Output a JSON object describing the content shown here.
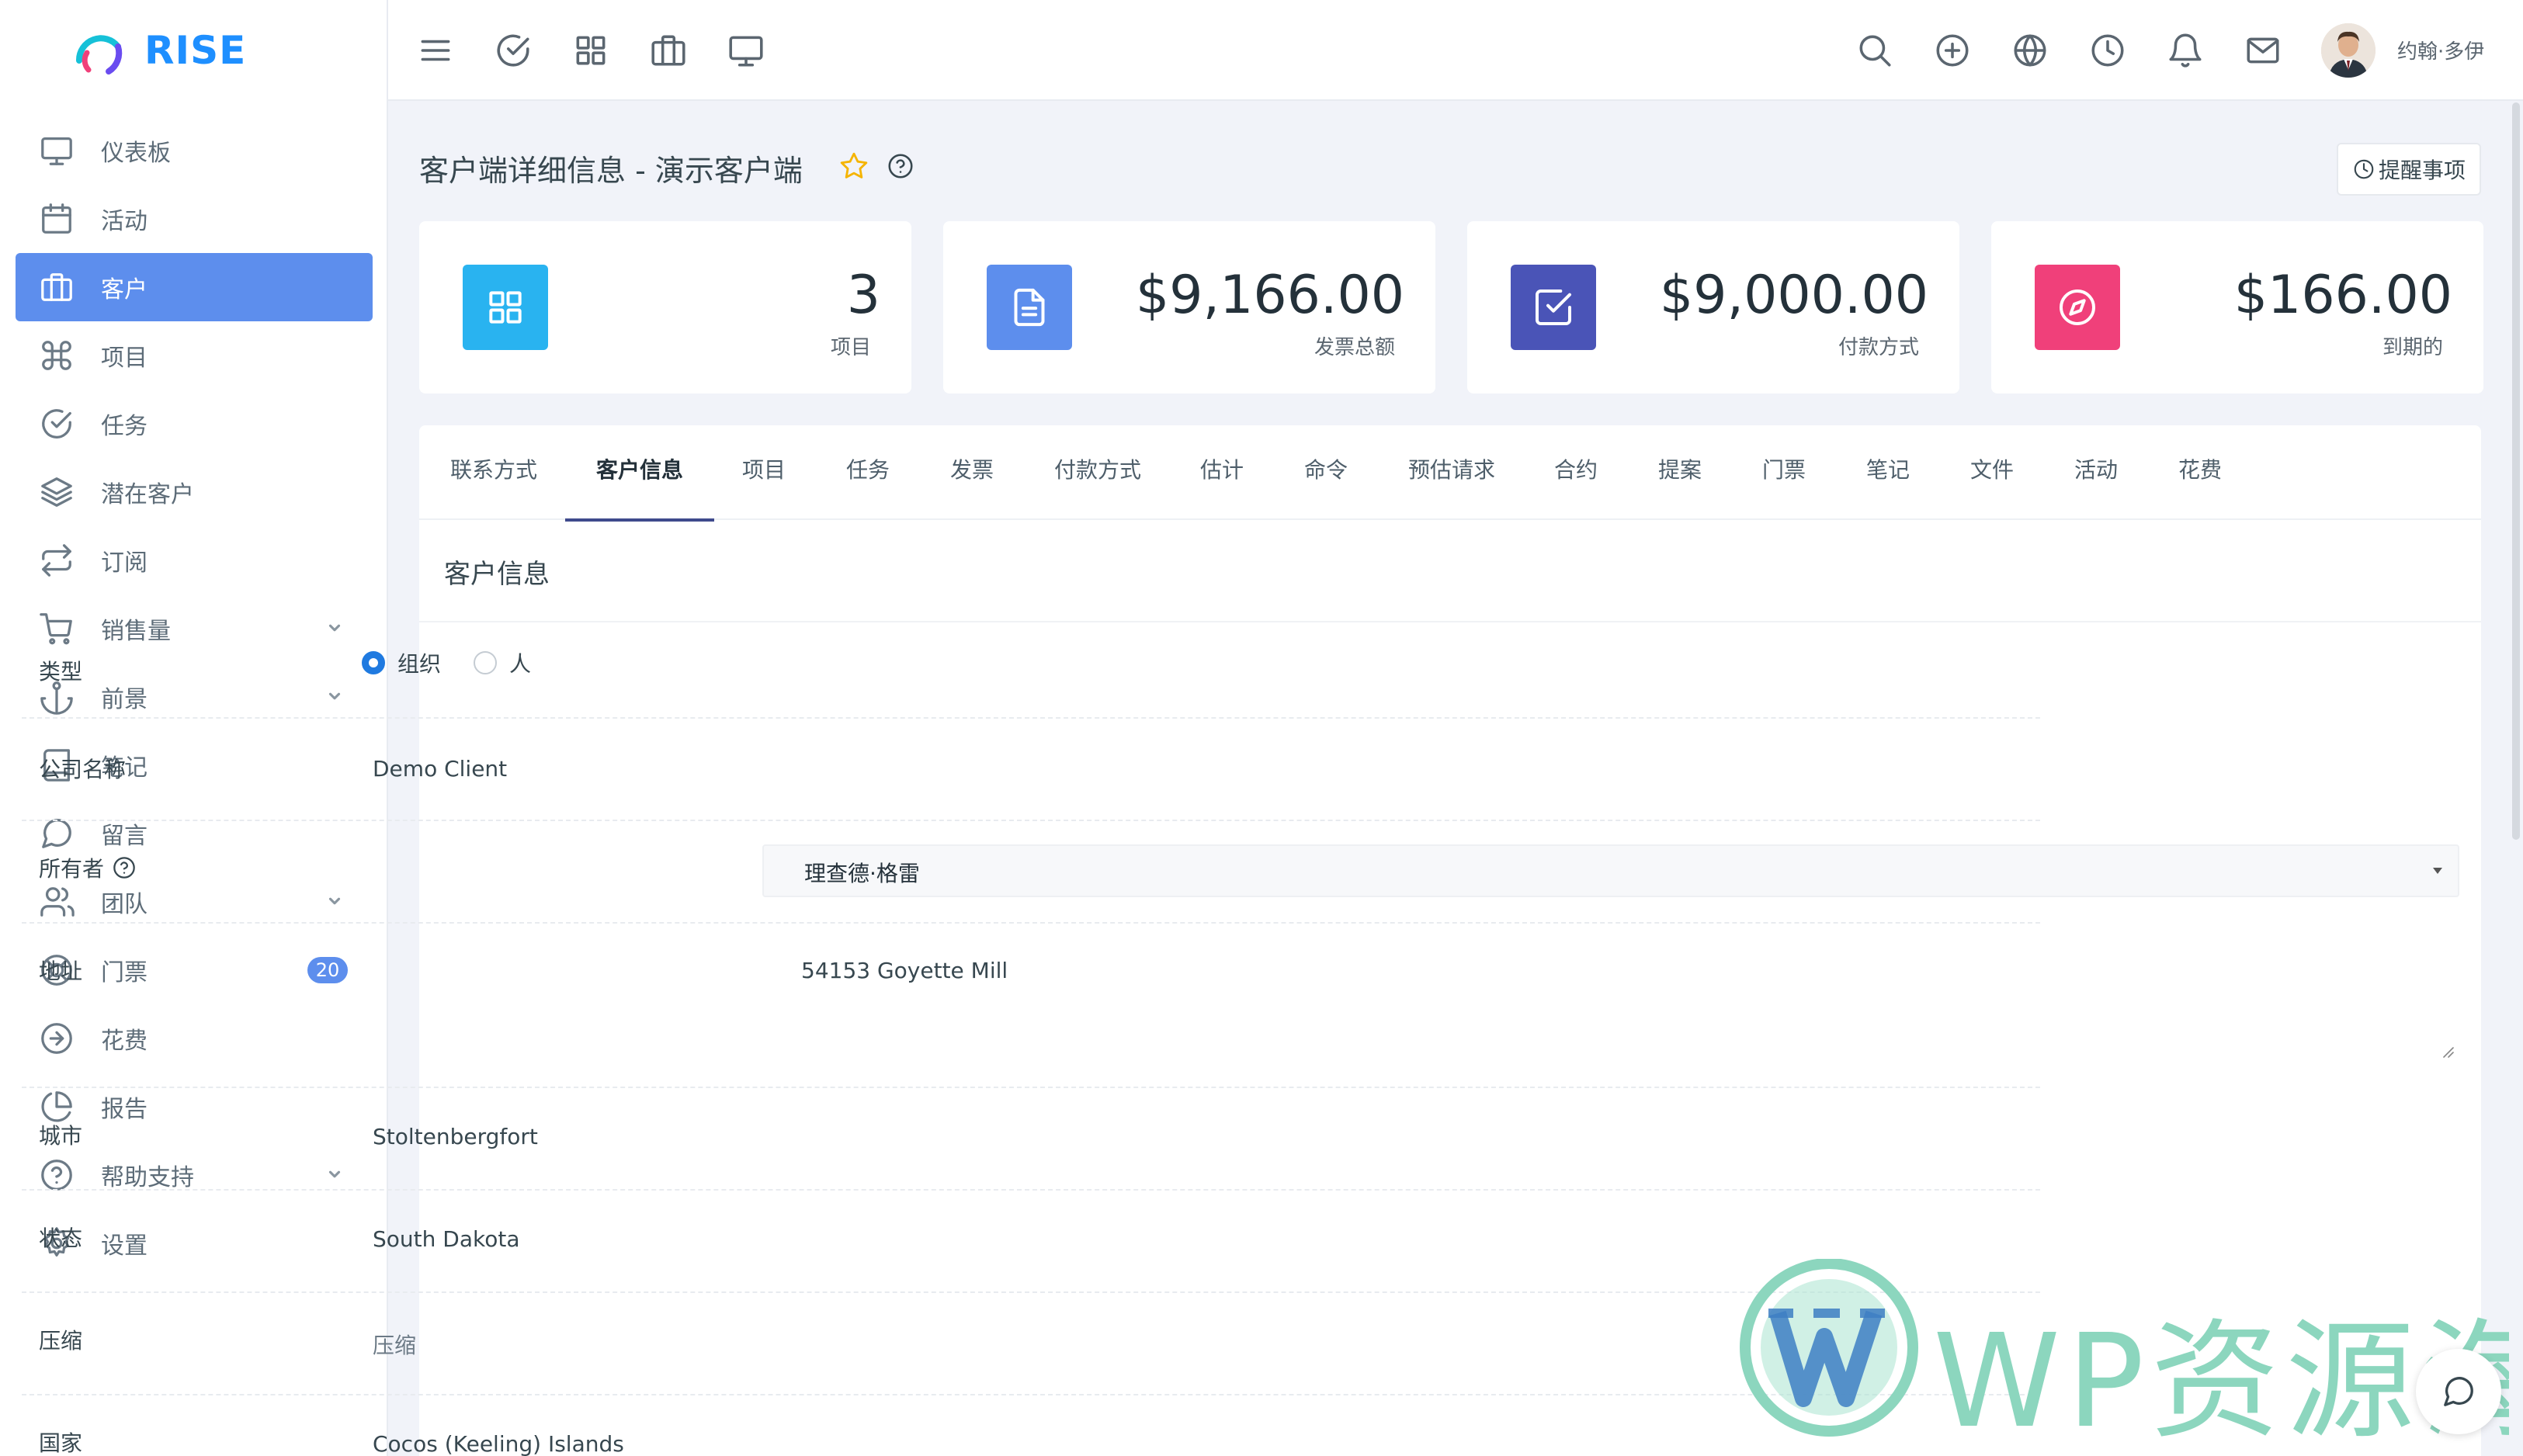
{
  "brand": {
    "name": "RISE"
  },
  "sidebar": {
    "items": [
      {
        "label": "仪表板",
        "icon": "monitor-icon"
      },
      {
        "label": "活动",
        "icon": "calendar-icon"
      },
      {
        "label": "客户",
        "icon": "briefcase-icon",
        "active": true
      },
      {
        "label": "项目",
        "icon": "command-icon"
      },
      {
        "label": "任务",
        "icon": "check-circle-icon"
      },
      {
        "label": "潜在客户",
        "icon": "layers-icon"
      },
      {
        "label": "订阅",
        "icon": "repeat-icon"
      },
      {
        "label": "销售量",
        "icon": "cart-icon",
        "expandable": true
      },
      {
        "label": "前景",
        "icon": "anchor-icon",
        "expandable": true
      },
      {
        "label": "笔记",
        "icon": "book-icon"
      },
      {
        "label": "留言",
        "icon": "message-icon"
      },
      {
        "label": "团队",
        "icon": "users-icon",
        "expandable": true
      },
      {
        "label": "门票",
        "icon": "life-buoy-icon",
        "badge": "20"
      },
      {
        "label": "花费",
        "icon": "arrow-circle-icon"
      },
      {
        "label": "报告",
        "icon": "pie-chart-icon"
      },
      {
        "label": "帮助支持",
        "icon": "help-circle-icon",
        "expandable": true
      },
      {
        "label": "设置",
        "icon": "settings-icon"
      }
    ]
  },
  "topbar": {
    "left_icons": [
      "menu-icon",
      "check-circle-icon",
      "grid-icon",
      "briefcase-icon",
      "monitor-icon"
    ],
    "right_icons": [
      "search-icon",
      "plus-circle-icon",
      "globe-icon",
      "clock-icon",
      "bell-icon",
      "mail-icon"
    ],
    "user_name": "约翰·多伊"
  },
  "page": {
    "title": "客户端详细信息 - 演示客户端",
    "reminder_label": "提醒事项"
  },
  "stats": [
    {
      "value": "3",
      "label": "项目",
      "color": "#29b3f0",
      "icon": "grid-icon"
    },
    {
      "value": "$9,166.00",
      "label": "发票总额",
      "color": "#5d8eed",
      "icon": "file-text-icon"
    },
    {
      "value": "$9,000.00",
      "label": "付款方式",
      "color": "#4a54b7",
      "icon": "check-square-icon"
    },
    {
      "value": "$166.00",
      "label": "到期的",
      "color": "#f0407a",
      "icon": "compass-icon"
    }
  ],
  "tabs": [
    {
      "label": "联系方式"
    },
    {
      "label": "客户信息",
      "active": true
    },
    {
      "label": "项目"
    },
    {
      "label": "任务"
    },
    {
      "label": "发票"
    },
    {
      "label": "付款方式"
    },
    {
      "label": "估计"
    },
    {
      "label": "命令"
    },
    {
      "label": "预估请求"
    },
    {
      "label": "合约"
    },
    {
      "label": "提案"
    },
    {
      "label": "门票"
    },
    {
      "label": "笔记"
    },
    {
      "label": "文件"
    },
    {
      "label": "活动"
    },
    {
      "label": "花费"
    }
  ],
  "form": {
    "section_title": "客户信息",
    "type": {
      "label": "类型",
      "options": [
        "组织",
        "人"
      ],
      "selected": "组织"
    },
    "company": {
      "label": "公司名称",
      "value": "Demo Client"
    },
    "owner": {
      "label": "所有者",
      "value": "理查德·格雷"
    },
    "address": {
      "label": "地址",
      "value": "54153 Goyette Mill"
    },
    "city": {
      "label": "城市",
      "value": "Stoltenbergfort"
    },
    "state": {
      "label": "状态",
      "value": "South Dakota"
    },
    "zip": {
      "label": "压缩",
      "value": "压缩"
    },
    "country": {
      "label": "国家",
      "value": "Cocos (Keeling) Islands"
    }
  },
  "watermark": {
    "text": "WP资源海"
  },
  "colors": {
    "accent": "#5d8eed",
    "brand": "#1e8fff",
    "active_tab_underline": "#3e4a8c",
    "radio": "#1f7ae0"
  }
}
